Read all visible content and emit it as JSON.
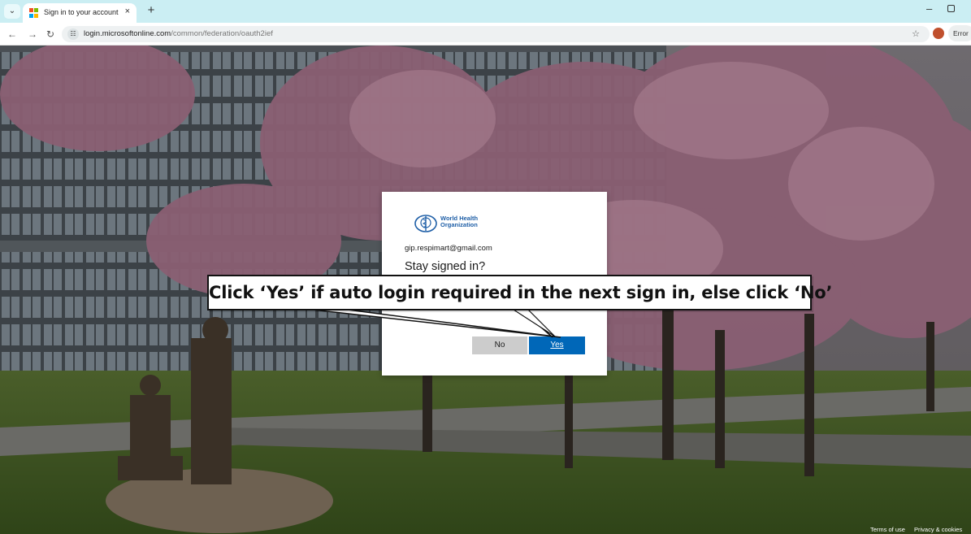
{
  "browser": {
    "tab_title": "Sign in to your account",
    "tab_close": "×",
    "new_tab": "+",
    "tab_menu_icon": "chevron-down",
    "url_host": "login.microsoftonline.com",
    "url_path": "/common/federation/oauth2ief",
    "error_label": "Error",
    "profile_initial": "⬤",
    "favicon_colors": [
      "#f25022",
      "#7fba00",
      "#00a4ef",
      "#ffb900"
    ]
  },
  "dialog": {
    "org_name_line1": "World Health",
    "org_name_line2": "Organization",
    "account_email": "gip.respimart@gmail.com",
    "title": "Stay signed in?",
    "no_label": "No",
    "yes_label": "Yes",
    "accent_color": "#0067b8"
  },
  "callout": {
    "text": "Click ‘Yes’ if auto login required in the next sign in, else click ‘No’"
  },
  "footer": {
    "terms_label": "Terms of use",
    "privacy_label": "Privacy & cookies"
  }
}
